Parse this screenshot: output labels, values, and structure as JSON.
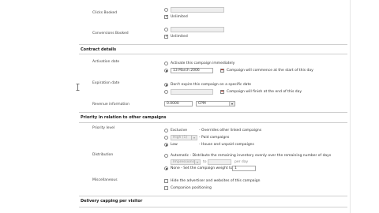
{
  "fields": {
    "clicks_booked": "Clicks Booked",
    "conversions_booked": "Conversions Booked",
    "unlimited": "Unlimited"
  },
  "contract": {
    "title": "Contract details",
    "activation_date": "Activation date",
    "activate_immediately": "Activate this campaign immediately",
    "activation_value": "13 March 2006",
    "activation_note": "Campaign will commence at the start of this day",
    "expiration_date": "Expiration date",
    "dont_expire": "Don't expire this campaign on a specific date",
    "expiration_note": "Campaign will finish at the end of this day",
    "revenue_label": "Revenue information",
    "revenue_value": "0.0000",
    "revenue_type": "CPM"
  },
  "priority": {
    "title": "Priority in relation to other campaigns",
    "priority_level": "Priority level",
    "exclusive": "Exclusive",
    "exclusive_note": "- Overrides other linked campaigns",
    "high_select": "High (1)",
    "high_note": "- Paid campaigns",
    "low": "Low",
    "low_note": "- House and unpaid campaigns",
    "distribution": "Distribution",
    "automatic": "Automatic - Distribute the remaining inventory evenly over the remaining number of days",
    "automatic_select": "Impressions",
    "to": "to",
    "per_day": "per day",
    "none_label": "None - Set the campaign weight to",
    "weight_value": "1",
    "miscellaneous": "Miscellaneous",
    "hide_advertiser": "Hide the advertiser and websites of this campaign",
    "companion": "Companion positioning"
  },
  "delivery": {
    "title": "Delivery capping per visitor"
  }
}
